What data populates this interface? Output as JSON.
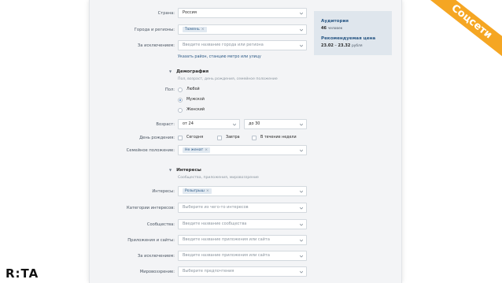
{
  "brand": {
    "logo_text": "R:TA",
    "ribbon_text": "Соцсети",
    "ribbon_color": "#f5a623"
  },
  "geo": {
    "country_label": "Страна:",
    "country_value": "Россия",
    "cities_label": "Города и регионы:",
    "cities_tag": "Тюмень",
    "except_label": "За исключением:",
    "except_placeholder": "Введите название города или региона",
    "point_link": "Указать район, станцию метро или улицу"
  },
  "demography": {
    "title": "Демография",
    "subtitle": "Пол, возраст, день рождения, семейное положение",
    "sex_label": "Пол:",
    "sex_options": [
      "Любой",
      "Мужской",
      "Женский"
    ],
    "sex_selected_index": 1,
    "age_label": "Возраст:",
    "age_from": "от 24",
    "age_to": "до 30",
    "birthday_label": "День рождения:",
    "birthday_options": [
      "Сегодня",
      "Завтра",
      "В течение недели"
    ],
    "marital_label": "Семейное положение:",
    "marital_tag": "Не женат"
  },
  "interests": {
    "title": "Интересы",
    "subtitle": "Сообщества, приложения, мировоззрение",
    "interests_label": "Интересы:",
    "interests_tag": "Розыгрыш",
    "categories_label": "Категории интересов:",
    "categories_placeholder": "Выберите из чего-то интересов",
    "communities_label": "Сообщества:",
    "communities_placeholder": "Введите название сообщества",
    "apps_label": "Приложения и сайты:",
    "apps_placeholder": "Введите название приложения или сайта",
    "except_label": "За исключением:",
    "except_placeholder": "Введите название приложения или сайта",
    "worldview_label": "Мировоззрение:",
    "worldview_placeholder": "Выберите предпочтения"
  },
  "audience": {
    "audience_title": "Аудитория",
    "audience_value": "46",
    "audience_unit": "человек",
    "price_title": "Рекомендуемая цена",
    "price_from": "23.02",
    "price_to": "23.32",
    "price_unit": "рубля"
  }
}
